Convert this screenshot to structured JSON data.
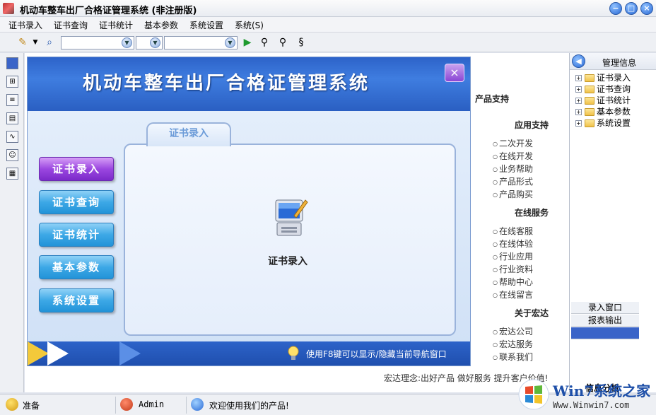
{
  "window": {
    "title": "机动车整车出厂合格证管理系统 (非注册版)"
  },
  "menu": [
    "证书录入",
    "证书查询",
    "证书统计",
    "基本参数",
    "系统设置",
    "系统(S)"
  ],
  "toolbar": {
    "icons": [
      "pencil-icon",
      "dropdown-arrow-icon",
      "search-icon",
      "play-icon",
      "find-icon",
      "zoom-icon",
      "refresh-icon"
    ]
  },
  "background": {
    "partial_heading": "产品支持",
    "sections": [
      {
        "heading": "应用支持",
        "links": [
          "二次开发",
          "在线开发",
          "业务帮助",
          "产品形式",
          "产品购买"
        ]
      },
      {
        "heading": "在线服务",
        "links": [
          "在线客服",
          "在线体验",
          "行业应用",
          "行业资料",
          "帮助中心",
          "在线留言"
        ]
      },
      {
        "heading": "关于宏达",
        "links": [
          "宏达公司",
          "宏达服务",
          "联系我们"
        ]
      }
    ],
    "footer": "宏达理念:出好产品 做好服务 提升客户价值!"
  },
  "dialog": {
    "title": "机动车整车出厂合格证管理系统",
    "close_label": "×",
    "nav_buttons": [
      "证书录入",
      "证书查询",
      "证书统计",
      "基本参数",
      "系统设置"
    ],
    "active_tab": "证书录入",
    "center_label": "证书录入",
    "footer_hint": "使用F8键可以显示/隐藏当前导航窗口"
  },
  "right_panel": {
    "title": "管理信息",
    "tree": [
      "证书录入",
      "证书查询",
      "证书统计",
      "基本参数",
      "系统设置"
    ],
    "sub_items": [
      "录入窗口",
      "报表输出"
    ],
    "bottom_label": "信息分析"
  },
  "status": {
    "ready": "准备",
    "user": "Admin",
    "welcome": "欢迎使用我们的产品!"
  },
  "watermark": {
    "text": "Win7系统之家",
    "url": "Www.Winwin7.com"
  },
  "colors": {
    "dialog_blue": "#2d63c9",
    "nav_blue": "#3da8e6",
    "nav_active": "#9b47e0",
    "tab_text": "#6b9bd8"
  }
}
